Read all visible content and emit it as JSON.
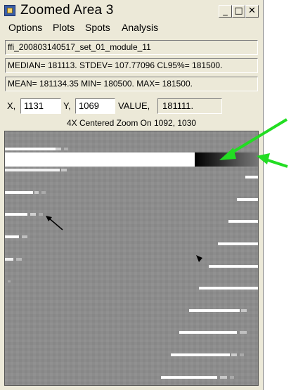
{
  "window": {
    "title": "Zoomed Area  3",
    "buttons": {
      "minimize": "_",
      "maximize": "□",
      "close": "✕"
    }
  },
  "menu": [
    "Options",
    "Plots",
    "Spots",
    "Analysis"
  ],
  "info": {
    "filename": "ffi_200803140517_set_01_module_11",
    "stats1": "MEDIAN= 181113. STDEV= 107.77096 CL95%= 181500.",
    "stats2": "MEAN= 181134.35 MIN= 180500. MAX= 181500."
  },
  "coords": {
    "x_label": "X,",
    "x_value": "1131",
    "y_label": "Y,",
    "y_value": "1069",
    "value_label": "VALUE,",
    "value": "181111."
  },
  "zoom": {
    "caption": "4X Centered Zoom On  1092, 1030"
  },
  "colors": {
    "window_bg": "#ece9d8",
    "image_bg": "#8c8c8c",
    "arrow_green": "#22dd22"
  }
}
